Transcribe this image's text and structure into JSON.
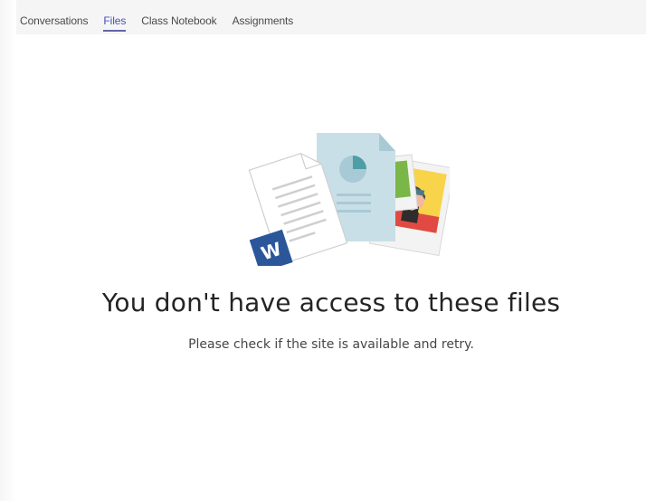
{
  "tabs": [
    {
      "label": "Conversations",
      "active": false
    },
    {
      "label": "Files",
      "active": true
    },
    {
      "label": "Class Notebook",
      "active": false
    },
    {
      "label": "Assignments",
      "active": false
    }
  ],
  "empty_state": {
    "title": "You don't have access to these files",
    "message": "Please check if the site is available and retry.",
    "illustration_icons": [
      "word-document-icon",
      "chart-document-icon",
      "photo-icon"
    ],
    "word_badge_letter": "W"
  },
  "colors": {
    "accent": "#6264a7",
    "word_blue": "#2b579a",
    "doc_teal": "#c7dfe6",
    "chart_teal": "#4f9ea6"
  }
}
